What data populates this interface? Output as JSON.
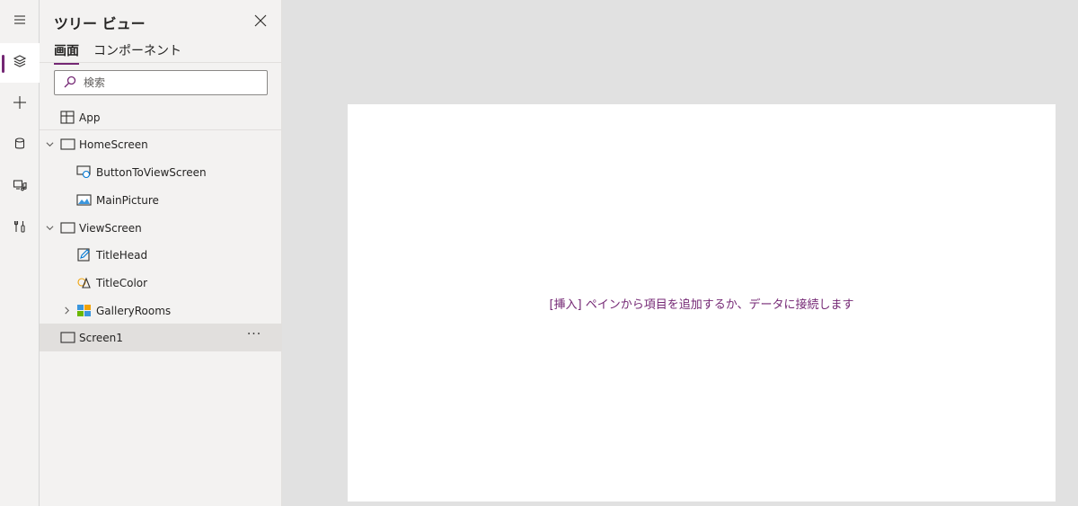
{
  "rail": {
    "items": [
      {
        "icon": "hamburger-menu-icon"
      },
      {
        "icon": "layers-icon",
        "active": true
      },
      {
        "icon": "plus-icon"
      },
      {
        "icon": "database-icon"
      },
      {
        "icon": "media-icon"
      },
      {
        "icon": "tools-icon"
      }
    ],
    "accent": "#742774"
  },
  "panel": {
    "title": "ツリー ビュー",
    "tabs": [
      {
        "label": "画面",
        "active": true
      },
      {
        "label": "コンポーネント",
        "active": false
      }
    ],
    "search": {
      "placeholder": "検索",
      "value": ""
    },
    "tree": [
      {
        "label": "App",
        "icon": "app-icon",
        "level": 0,
        "expandable": false
      },
      {
        "label": "HomeScreen",
        "icon": "screen-icon",
        "level": 0,
        "expandable": true,
        "expanded": true
      },
      {
        "label": "ButtonToViewScreen",
        "icon": "button-icon",
        "level": 1
      },
      {
        "label": "MainPicture",
        "icon": "image-icon",
        "level": 1
      },
      {
        "label": "ViewScreen",
        "icon": "screen-icon",
        "level": 0,
        "expandable": true,
        "expanded": true
      },
      {
        "label": "TitleHead",
        "icon": "label-edit-icon",
        "level": 1
      },
      {
        "label": "TitleColor",
        "icon": "shape-icon",
        "level": 1
      },
      {
        "label": "GalleryRooms",
        "icon": "gallery-icon",
        "level": 1,
        "expandable": true,
        "expanded": false
      },
      {
        "label": "Screen1",
        "icon": "screen-icon",
        "level": 0,
        "selected": true,
        "more": "···"
      }
    ]
  },
  "canvas": {
    "message": "[挿入] ペインから項目を追加するか、データに接続します"
  }
}
